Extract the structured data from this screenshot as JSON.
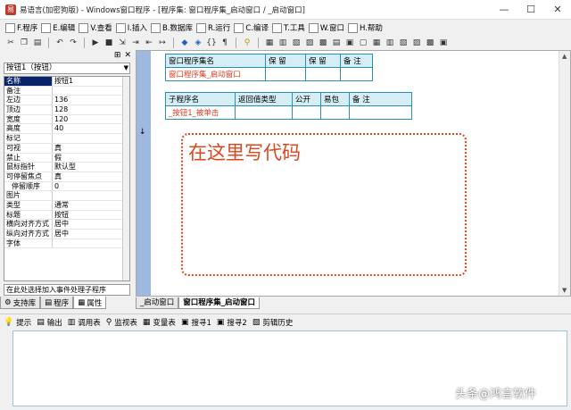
{
  "window": {
    "title": "易语言(加密狗版) - Windows窗口程序 - [程序集: 窗口程序集_启动窗口 / _启动窗口]",
    "minimize": "—",
    "maximize": "☐",
    "close": "✕"
  },
  "menu": [
    "F.程序",
    "E.编辑",
    "V.查看",
    "I.插入",
    "B.数据库",
    "R.运行",
    "C.编译",
    "T.工具",
    "W.窗口",
    "H.帮助"
  ],
  "left": {
    "selector": "按钮1（按钮）",
    "props": [
      [
        "名称",
        "按钮1"
      ],
      [
        "备注",
        ""
      ],
      [
        "左边",
        "136"
      ],
      [
        "顶边",
        "128"
      ],
      [
        "宽度",
        "120"
      ],
      [
        "高度",
        "40"
      ],
      [
        "标记",
        ""
      ],
      [
        "可视",
        "真"
      ],
      [
        "禁止",
        "假"
      ],
      [
        "鼠标指针",
        "默认型"
      ],
      [
        "可停留焦点",
        "真"
      ],
      [
        "停留顺序",
        "0"
      ],
      [
        "图片",
        ""
      ],
      [
        "类型",
        "通常"
      ],
      [
        "标题",
        "按钮"
      ],
      [
        "横向对齐方式",
        "居中"
      ],
      [
        "纵向对齐方式",
        "居中"
      ],
      [
        "字体",
        ""
      ]
    ],
    "hint": "在此处选择加入事件处理子程序",
    "tabs": [
      "支持库",
      "程序",
      "属性"
    ]
  },
  "editor": {
    "t1": {
      "headers": [
        "窗口程序集名",
        "保  留",
        "保  留",
        "备 注"
      ],
      "row": [
        "窗口程序集_启动窗口",
        "",
        "",
        ""
      ]
    },
    "t2": {
      "headers": [
        "子程序名",
        "返回值类型",
        "公开",
        "易包",
        "备  注"
      ],
      "row": [
        "_按钮1_被单击",
        "",
        "",
        "",
        ""
      ]
    },
    "placeholder": "在这里写代码",
    "tabs": [
      "_启动窗口",
      "窗口程序集_启动窗口"
    ]
  },
  "bottom": {
    "tabs": [
      "提示",
      "输出",
      "调用表",
      "监视表",
      "变量表",
      "搜寻1",
      "搜寻2",
      "剪辑历史"
    ]
  },
  "watermark": "头条@鸿言软件"
}
